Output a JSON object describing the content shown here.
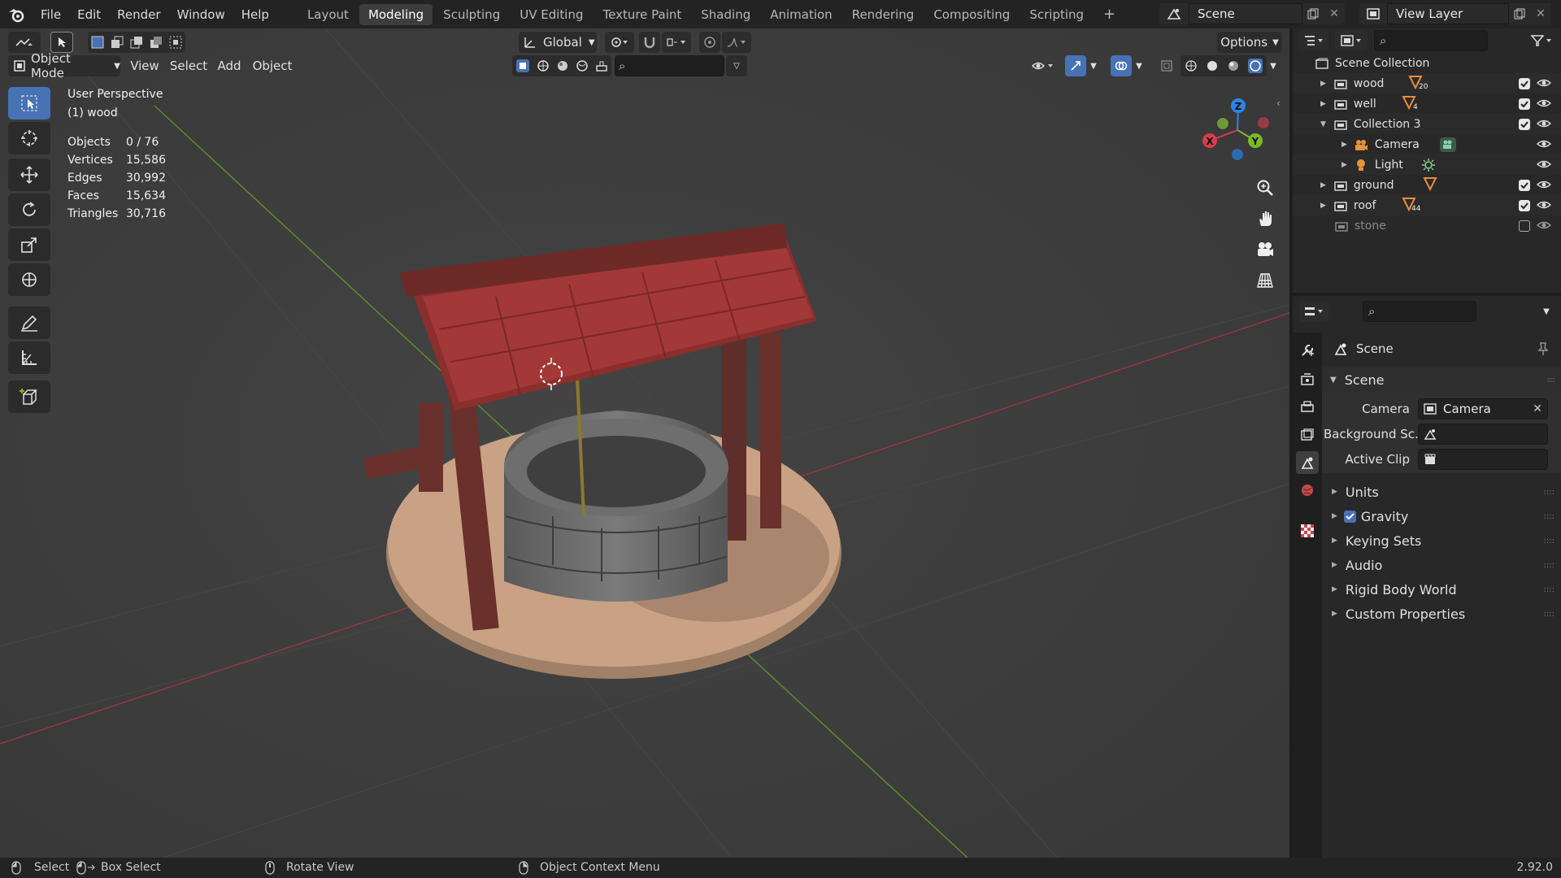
{
  "topbar": {
    "menus": [
      "File",
      "Edit",
      "Render",
      "Window",
      "Help"
    ],
    "workspaces": [
      "Layout",
      "Modeling",
      "Sculpting",
      "UV Editing",
      "Texture Paint",
      "Shading",
      "Animation",
      "Rendering",
      "Compositing",
      "Scripting"
    ],
    "active_workspace": "Modeling",
    "scene_name": "Scene",
    "view_layer_name": "View Layer"
  },
  "viewport": {
    "mode_label": "Object Mode",
    "menus": [
      "View",
      "Select",
      "Add",
      "Object"
    ],
    "transform_orientation": "Global",
    "options_label": "Options",
    "overlay_title": "User Perspective",
    "overlay_subtitle": "(1) wood",
    "stats": [
      {
        "label": "Objects",
        "value": "0 / 76"
      },
      {
        "label": "Vertices",
        "value": "15,586"
      },
      {
        "label": "Edges",
        "value": "30,992"
      },
      {
        "label": "Faces",
        "value": "15,634"
      },
      {
        "label": "Triangles",
        "value": "30,716"
      }
    ],
    "gizmo_axes": [
      "X",
      "Y",
      "Z"
    ],
    "colors": {
      "x_axis": "#d63c4f",
      "y_axis": "#7ab929",
      "z_axis": "#2f83e6"
    }
  },
  "outliner": {
    "root": "Scene Collection",
    "items": [
      {
        "name": "wood",
        "badge": "20",
        "checked": true
      },
      {
        "name": "well",
        "badge": "4",
        "checked": true
      },
      {
        "name": "Collection 3",
        "badge": "",
        "checked": true
      },
      {
        "name": "Camera",
        "badge": "",
        "checked": null
      },
      {
        "name": "Light",
        "badge": "",
        "checked": null
      },
      {
        "name": "ground",
        "badge": "",
        "checked": true
      },
      {
        "name": "roof",
        "badge": "44",
        "checked": true
      },
      {
        "name": "stone",
        "badge": "",
        "checked": false
      }
    ]
  },
  "properties": {
    "context_title": "Scene",
    "panel_title": "Scene",
    "fields": [
      {
        "label": "Camera",
        "value": "Camera"
      },
      {
        "label": "Background Sc...",
        "value": ""
      },
      {
        "label": "Active Clip",
        "value": ""
      }
    ],
    "subpanels": [
      "Units",
      "Gravity",
      "Keying Sets",
      "Audio",
      "Rigid Body World",
      "Custom Properties"
    ],
    "gravity_checked": true
  },
  "statusbar": {
    "hints": [
      "Select",
      "Box Select",
      "Rotate View",
      "Object Context Menu"
    ],
    "version": "2.92.0"
  }
}
